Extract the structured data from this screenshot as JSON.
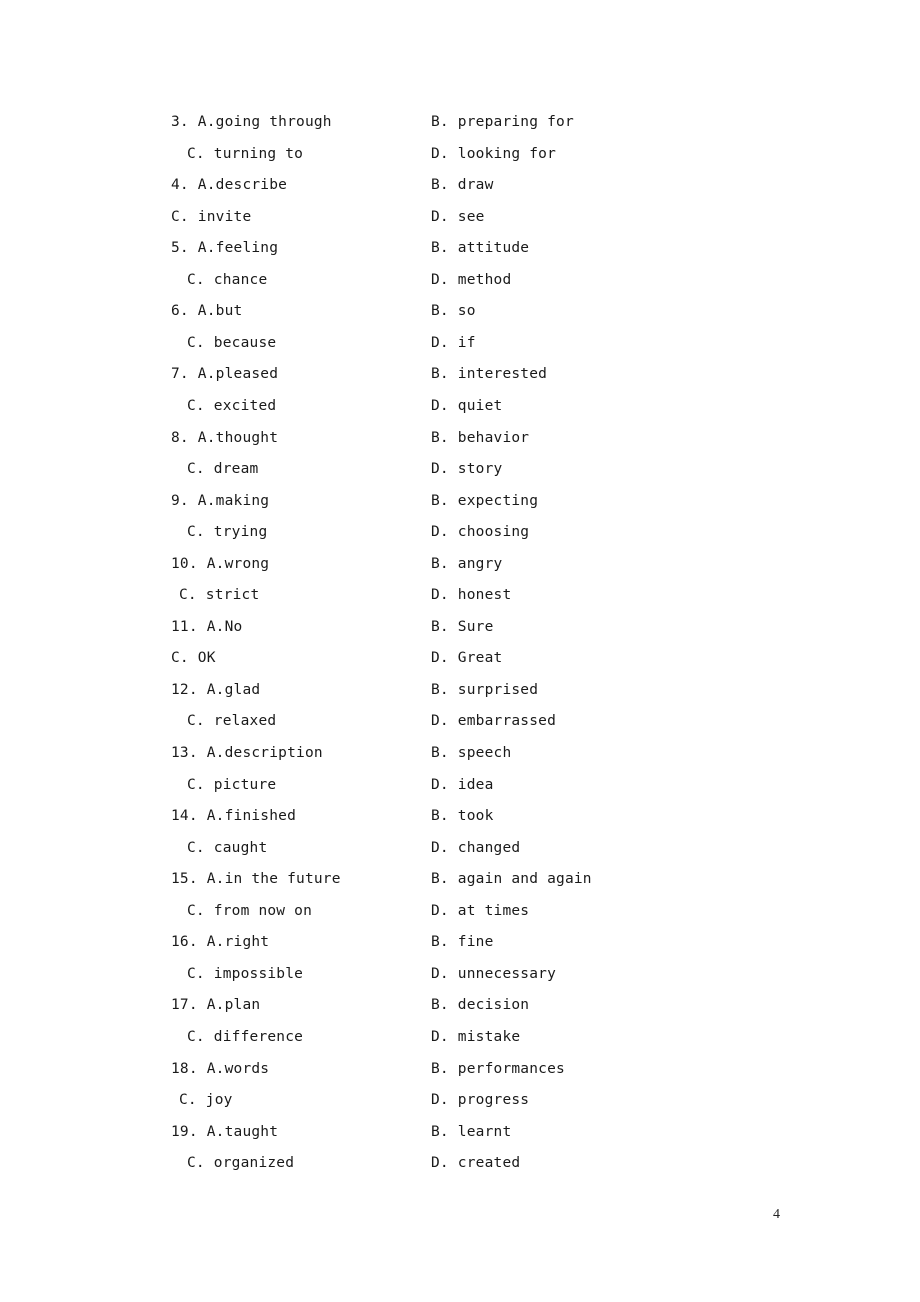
{
  "rows": [
    {
      "left": "3. A.going through",
      "right": "B. preparing for",
      "indent": "none"
    },
    {
      "left": "C. turning to",
      "right": "D. looking for",
      "indent": "full"
    },
    {
      "left": "4. A.describe",
      "right": "B. draw",
      "indent": "none"
    },
    {
      "left": "C. invite",
      "right": "D. see",
      "indent": "none"
    },
    {
      "left": "5. A.feeling",
      "right": "B. attitude",
      "indent": "none"
    },
    {
      "left": "C. chance",
      "right": "D. method",
      "indent": "full"
    },
    {
      "left": "6. A.but",
      "right": "B. so",
      "indent": "none"
    },
    {
      "left": "C. because",
      "right": "D. if",
      "indent": "full"
    },
    {
      "left": "7. A.pleased",
      "right": "B. interested",
      "indent": "none"
    },
    {
      "left": "C. excited",
      "right": "D. quiet",
      "indent": "full"
    },
    {
      "left": "8. A.thought",
      "right": "B. behavior",
      "indent": "none"
    },
    {
      "left": "C. dream",
      "right": "D. story",
      "indent": "full"
    },
    {
      "left": "9. A.making",
      "right": "B. expecting",
      "indent": "none"
    },
    {
      "left": "C. trying",
      "right": "D. choosing",
      "indent": "full"
    },
    {
      "left": "10. A.wrong",
      "right": "B. angry",
      "indent": "none"
    },
    {
      "left": "C. strict",
      "right": "D. honest",
      "indent": "half"
    },
    {
      "left": "11. A.No",
      "right": "B. Sure",
      "indent": "none"
    },
    {
      "left": "C. OK",
      "right": "D. Great",
      "indent": "none"
    },
    {
      "left": "12. A.glad",
      "right": "B. surprised",
      "indent": "none"
    },
    {
      "left": "C. relaxed",
      "right": "D. embarrassed",
      "indent": "full"
    },
    {
      "left": "13. A.description",
      "right": "B. speech",
      "indent": "none"
    },
    {
      "left": "C. picture",
      "right": "D. idea",
      "indent": "full"
    },
    {
      "left": "14. A.finished",
      "right": "B. took",
      "indent": "none"
    },
    {
      "left": "C. caught",
      "right": "D. changed",
      "indent": "full"
    },
    {
      "left": "15. A.in the future",
      "right": "B. again and again",
      "indent": "none"
    },
    {
      "left": "C. from now on",
      "right": "D. at times",
      "indent": "full"
    },
    {
      "left": "16. A.right",
      "right": "B. fine",
      "indent": "none"
    },
    {
      "left": "C. impossible",
      "right": "D. unnecessary",
      "indent": "full"
    },
    {
      "left": "17. A.plan",
      "right": "B. decision",
      "indent": "none"
    },
    {
      "left": "C. difference",
      "right": "D. mistake",
      "indent": "full"
    },
    {
      "left": "18. A.words",
      "right": "B. performances",
      "indent": "none"
    },
    {
      "left": "C. joy",
      "right": "D. progress",
      "indent": "half"
    },
    {
      "left": "19. A.taught",
      "right": "B. learnt",
      "indent": "none"
    },
    {
      "left": "C. organized",
      "right": "D. created",
      "indent": "full"
    }
  ],
  "page_number": "4"
}
